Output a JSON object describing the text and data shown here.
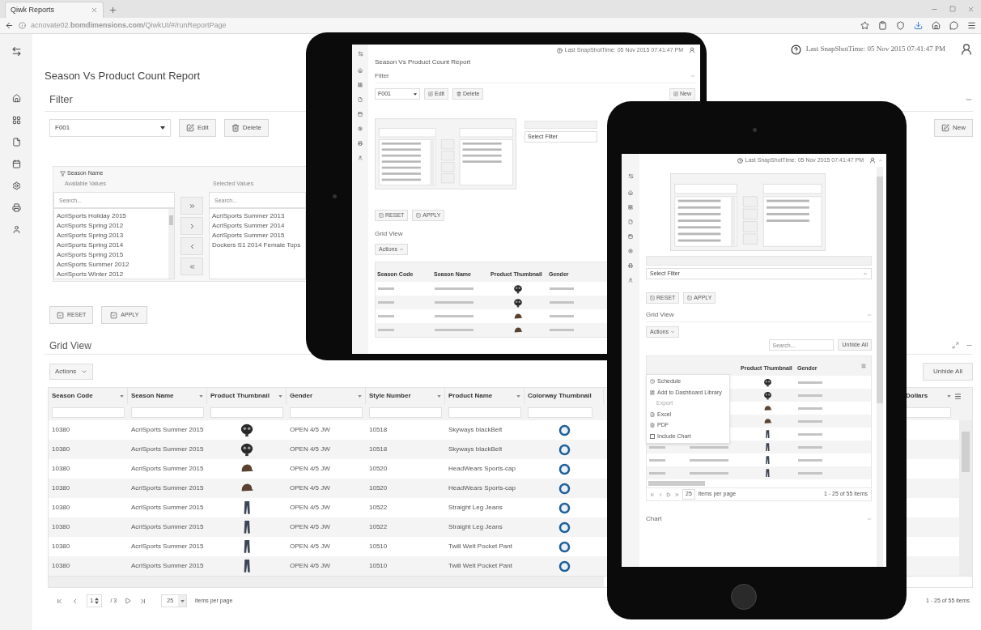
{
  "browser": {
    "tab_title": "Qiwk Reports",
    "url": "acnovate02.**bomdimensions.com**/QiwkUI/#/runReportPage"
  },
  "header": {
    "snapshot": "Last SnapShotTime: 05 Nov 2015 07:41:47 PM"
  },
  "report": {
    "title": "Season Vs Product Count Report",
    "filter": {
      "title": "Filter",
      "saved_filter": "F001",
      "edit": "Edit",
      "delete": "Delete",
      "new": "New",
      "field": {
        "label": "Season Name",
        "available_label": "Available Values",
        "selected_label": "Selected Values",
        "available_placeholder": "Search...",
        "selected_placeholder": "Search...",
        "available": [
          "AcriSports Holiday 2015",
          "AcriSports Spring 2012",
          "AcriSports Spring 2013",
          "AcriSports Spring 2014",
          "AcriSports Spring 2015",
          "AcriSports Summer 2012",
          "AcriSports Winter 2012"
        ],
        "selected": [
          "AcriSports Summer 2013",
          "AcriSports Summer 2014",
          "AcriSports Summer 2015",
          "Dockers S1 2014 Female Tops"
        ]
      },
      "reset": "RESET",
      "apply": "APPLY"
    },
    "grid": {
      "title": "Grid View",
      "actions": "Actions",
      "unhide_all": "Unhide All",
      "columns": [
        "Season Code",
        "Season Name",
        "Product Thumbnail",
        "Gender",
        "Style Number",
        "Product Name",
        "Colorway Thumbnail"
      ],
      "last_column": "Dollars",
      "rows": [
        {
          "season_code": "10380",
          "season_name": "AcriSports Summer 2015",
          "kind": "belt",
          "gender": "OPEN 4/5 JW",
          "style_number": "10518",
          "product_name": "Skyways blackBelt"
        },
        {
          "season_code": "10380",
          "season_name": "AcriSports Summer 2015",
          "kind": "belt",
          "gender": "OPEN 4/5 JW",
          "style_number": "10518",
          "product_name": "Skyways blackBelt"
        },
        {
          "season_code": "10380",
          "season_name": "AcriSports Summer 2015",
          "kind": "cap",
          "gender": "OPEN 4/5 JW",
          "style_number": "10520",
          "product_name": "HeadWears Sports-cap"
        },
        {
          "season_code": "10380",
          "season_name": "AcriSports Summer 2015",
          "kind": "cap",
          "gender": "OPEN 4/5 JW",
          "style_number": "10520",
          "product_name": "HeadWears Sports-cap"
        },
        {
          "season_code": "10380",
          "season_name": "AcriSports Summer 2015",
          "kind": "pants",
          "gender": "OPEN 4/5 JW",
          "style_number": "10522",
          "product_name": "Straight Leg Jeans"
        },
        {
          "season_code": "10380",
          "season_name": "AcriSports Summer 2015",
          "kind": "pants",
          "gender": "OPEN 4/5 JW",
          "style_number": "10522",
          "product_name": "Straight Leg Jeans"
        },
        {
          "season_code": "10380",
          "season_name": "AcriSports Summer 2015",
          "kind": "pants",
          "gender": "OPEN 4/5 JW",
          "style_number": "10510",
          "product_name": "Twill Welt Pocket Pant"
        },
        {
          "season_code": "10380",
          "season_name": "AcriSports Summer 2015",
          "kind": "pants",
          "gender": "OPEN 4/5 JW",
          "style_number": "10510",
          "product_name": "Twill Welt Pocket Pant"
        }
      ],
      "pager": {
        "page": "1",
        "of": "/ 3",
        "per_page": "25",
        "per_page_label": "items per page",
        "summary": "1 - 25 of 55 items"
      }
    }
  },
  "tablet_back": {
    "snapshot": "Last SnapShotTime: 05 Nov 2015 07:41:47 PM",
    "title": "Season Vs Product Count Report",
    "filter_title": "Filter",
    "saved_filter": "F001",
    "edit": "Edit",
    "delete": "Delete",
    "new": "New",
    "select_filter": "Select Filter",
    "reset": "RESET",
    "apply": "APPLY",
    "grid_title": "Grid View",
    "actions": "Actions",
    "columns": [
      "Season Code",
      "Season Name",
      "Product Thumbnail",
      "Gender"
    ],
    "rows": [
      {
        "kind": "belt"
      },
      {
        "kind": "belt"
      },
      {
        "kind": "cap"
      },
      {
        "kind": "cap"
      }
    ]
  },
  "tablet_front": {
    "snapshot": "Last SnapShotTime: 05 Nov 2015 07:41:47 PM",
    "select_filter": "Select Filter",
    "reset": "RESET",
    "apply": "APPLY",
    "grid_title": "Grid View",
    "actions": "Actions",
    "menu": [
      {
        "kind": "item",
        "label": "Schedule"
      },
      {
        "kind": "item",
        "label": "Add to Dashboard Library"
      },
      {
        "kind": "header",
        "label": "Export"
      },
      {
        "kind": "item",
        "label": "Excel"
      },
      {
        "kind": "item",
        "label": "PDF"
      },
      {
        "kind": "check",
        "label": "Include Chart",
        "checked": false
      }
    ],
    "search_placeholder": "Search...",
    "unhide_all": "Unhide All",
    "columns": [
      "Product Thumbnail",
      "Gender"
    ],
    "rows": [
      {
        "kind": "belt"
      },
      {
        "kind": "belt"
      },
      {
        "kind": "cap"
      },
      {
        "kind": "cap"
      },
      {
        "kind": "pants"
      },
      {
        "kind": "pants"
      },
      {
        "kind": "pants"
      },
      {
        "kind": "pants"
      }
    ],
    "per_page": "25",
    "per_page_label": "items per page",
    "summary": "1 - 25 of 55 items",
    "chart_title": "Chart"
  }
}
